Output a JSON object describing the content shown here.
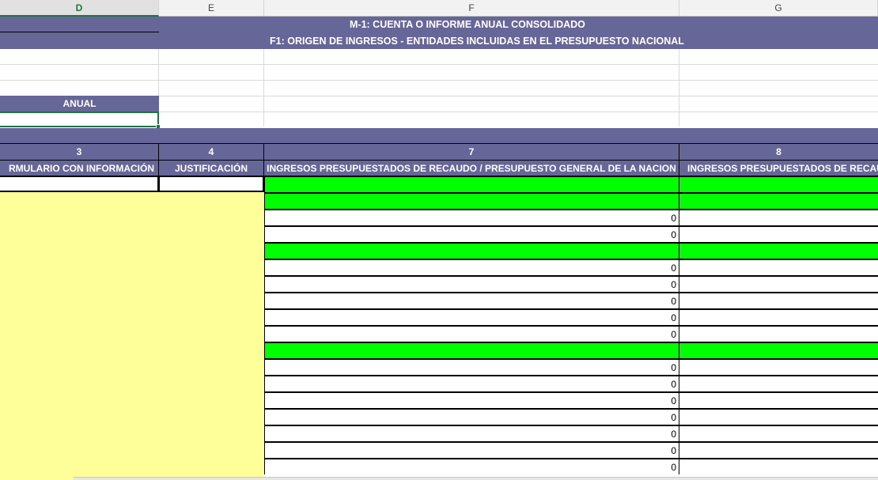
{
  "columns": [
    {
      "letter": "D",
      "selected": true
    },
    {
      "letter": "E",
      "selected": false
    },
    {
      "letter": "F",
      "selected": false
    },
    {
      "letter": "G",
      "selected": false
    }
  ],
  "banner": {
    "title_line1": "M-1: CUENTA O INFORME ANUAL CONSOLIDADO",
    "title_line2": "F1: ORIGEN DE INGRESOS - ENTIDADES INCLUIDAS EN EL PRESUPUESTO NACIONAL"
  },
  "period_label": "ANUAL",
  "header_numbers": [
    "3",
    "4",
    "7",
    "8"
  ],
  "header_labels": [
    "RMULARIO CON INFORMACIÓN",
    "JUSTIFICACIÓN",
    "INGRESOS PRESUPUESTADOS DE RECAUDO / PRESUPUESTO GENERAL DE LA NACION",
    "INGRESOS PRESUPUESTADOS DE RECAU"
  ],
  "rows": [
    {
      "type": "green",
      "value": ""
    },
    {
      "type": "green",
      "value": ""
    },
    {
      "type": "value",
      "value": "0"
    },
    {
      "type": "value",
      "value": "0"
    },
    {
      "type": "green",
      "value": ""
    },
    {
      "type": "value",
      "value": "0"
    },
    {
      "type": "value",
      "value": "0"
    },
    {
      "type": "value",
      "value": "0"
    },
    {
      "type": "value",
      "value": "0"
    },
    {
      "type": "value",
      "value": "0"
    },
    {
      "type": "green",
      "value": ""
    },
    {
      "type": "value",
      "value": "0"
    },
    {
      "type": "value",
      "value": "0"
    },
    {
      "type": "value",
      "value": "0"
    },
    {
      "type": "value",
      "value": "0"
    },
    {
      "type": "value",
      "value": "0"
    },
    {
      "type": "value",
      "value": "0"
    },
    {
      "type": "value",
      "value": "0"
    }
  ],
  "colors": {
    "banner": "#666699",
    "highlight_green": "#00ff00",
    "note_yellow": "#ffff99",
    "selection_green": "#217346"
  }
}
